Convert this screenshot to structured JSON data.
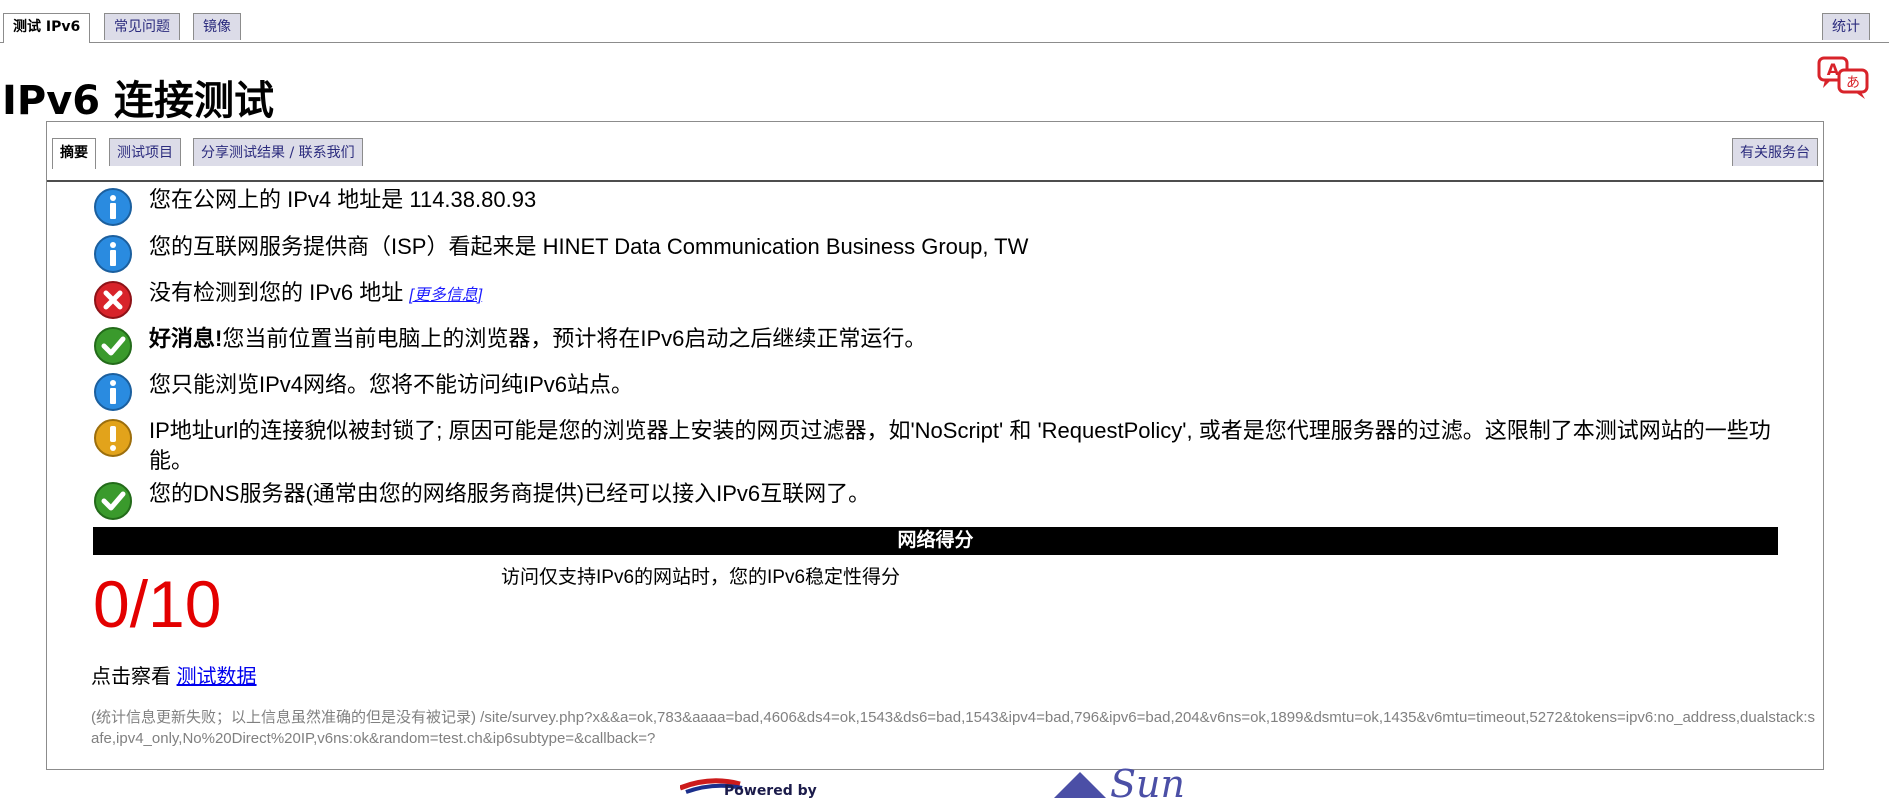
{
  "top_tabs": [
    "测试 IPv6",
    "常见问题",
    "镜像"
  ],
  "stats_tab": "统计",
  "page_title": "IPv6 连接测试",
  "sub_tabs": [
    "摘要",
    "测试项目",
    "分享测试结果 / 联系我们"
  ],
  "helpdesk_tab": "有关服务台",
  "messages": [
    {
      "icon": "info",
      "text": "您在公网上的 IPv4 地址是 114.38.80.93"
    },
    {
      "icon": "info",
      "text": "您的互联网服务提供商（ISP）看起来是 HINET Data Communication Business Group, TW"
    },
    {
      "icon": "error",
      "text": "没有检测到您的 IPv6 地址",
      "link": "[更多信息]"
    },
    {
      "icon": "ok",
      "bold": "好消息!",
      "text": "您当前位置当前电脑上的浏览器，预计将在IPv6启动之后继续正常运行。"
    },
    {
      "icon": "info",
      "text": "您只能浏览IPv4网络。您将不能访问纯IPv6站点。"
    },
    {
      "icon": "warning",
      "text": "IP地址url的连接貌似被封锁了; 原因可能是您的浏览器上安装的网页过滤器，如'NoScript' 和 'RequestPolicy', 或者是您代理服务器的过滤。这限制了本测试网站的一些功能。"
    },
    {
      "icon": "ok",
      "text": "您的DNS服务器(通常由您的网络服务商提供)已经可以接入IPv6互联网了。"
    }
  ],
  "score": {
    "heading": "网络得分",
    "value": "0/10",
    "description": "访问仅支持IPv6的网站时，您的IPv6稳定性得分"
  },
  "see_data": {
    "prefix": "点击察看 ",
    "link": "测试数据"
  },
  "stats_text": "(统计信息更新失败；以上信息虽然准确的但是没有被记录) /site/survey.php?x&&a=ok,783&aaaa=bad,4606&ds4=ok,1543&ds6=bad,1543&ipv4=bad,796&ipv6=bad,204&v6ns=ok,1899&dsmtu=ok,1435&v6mtu=timeout,5272&tokens=ipv6:no_address,dualstack:safe,ipv4_only,No%20Direct%20IP,v6ns:ok&random=test.ch&ip6subtype=&callback=?",
  "footer": {
    "powered_by": "Powered by",
    "sun": "Sun"
  },
  "colors": {
    "info": "#2a8be0",
    "error": "#d8232a",
    "ok": "#3a9a2c",
    "warning": "#e2a31b",
    "score": "#e30000"
  }
}
